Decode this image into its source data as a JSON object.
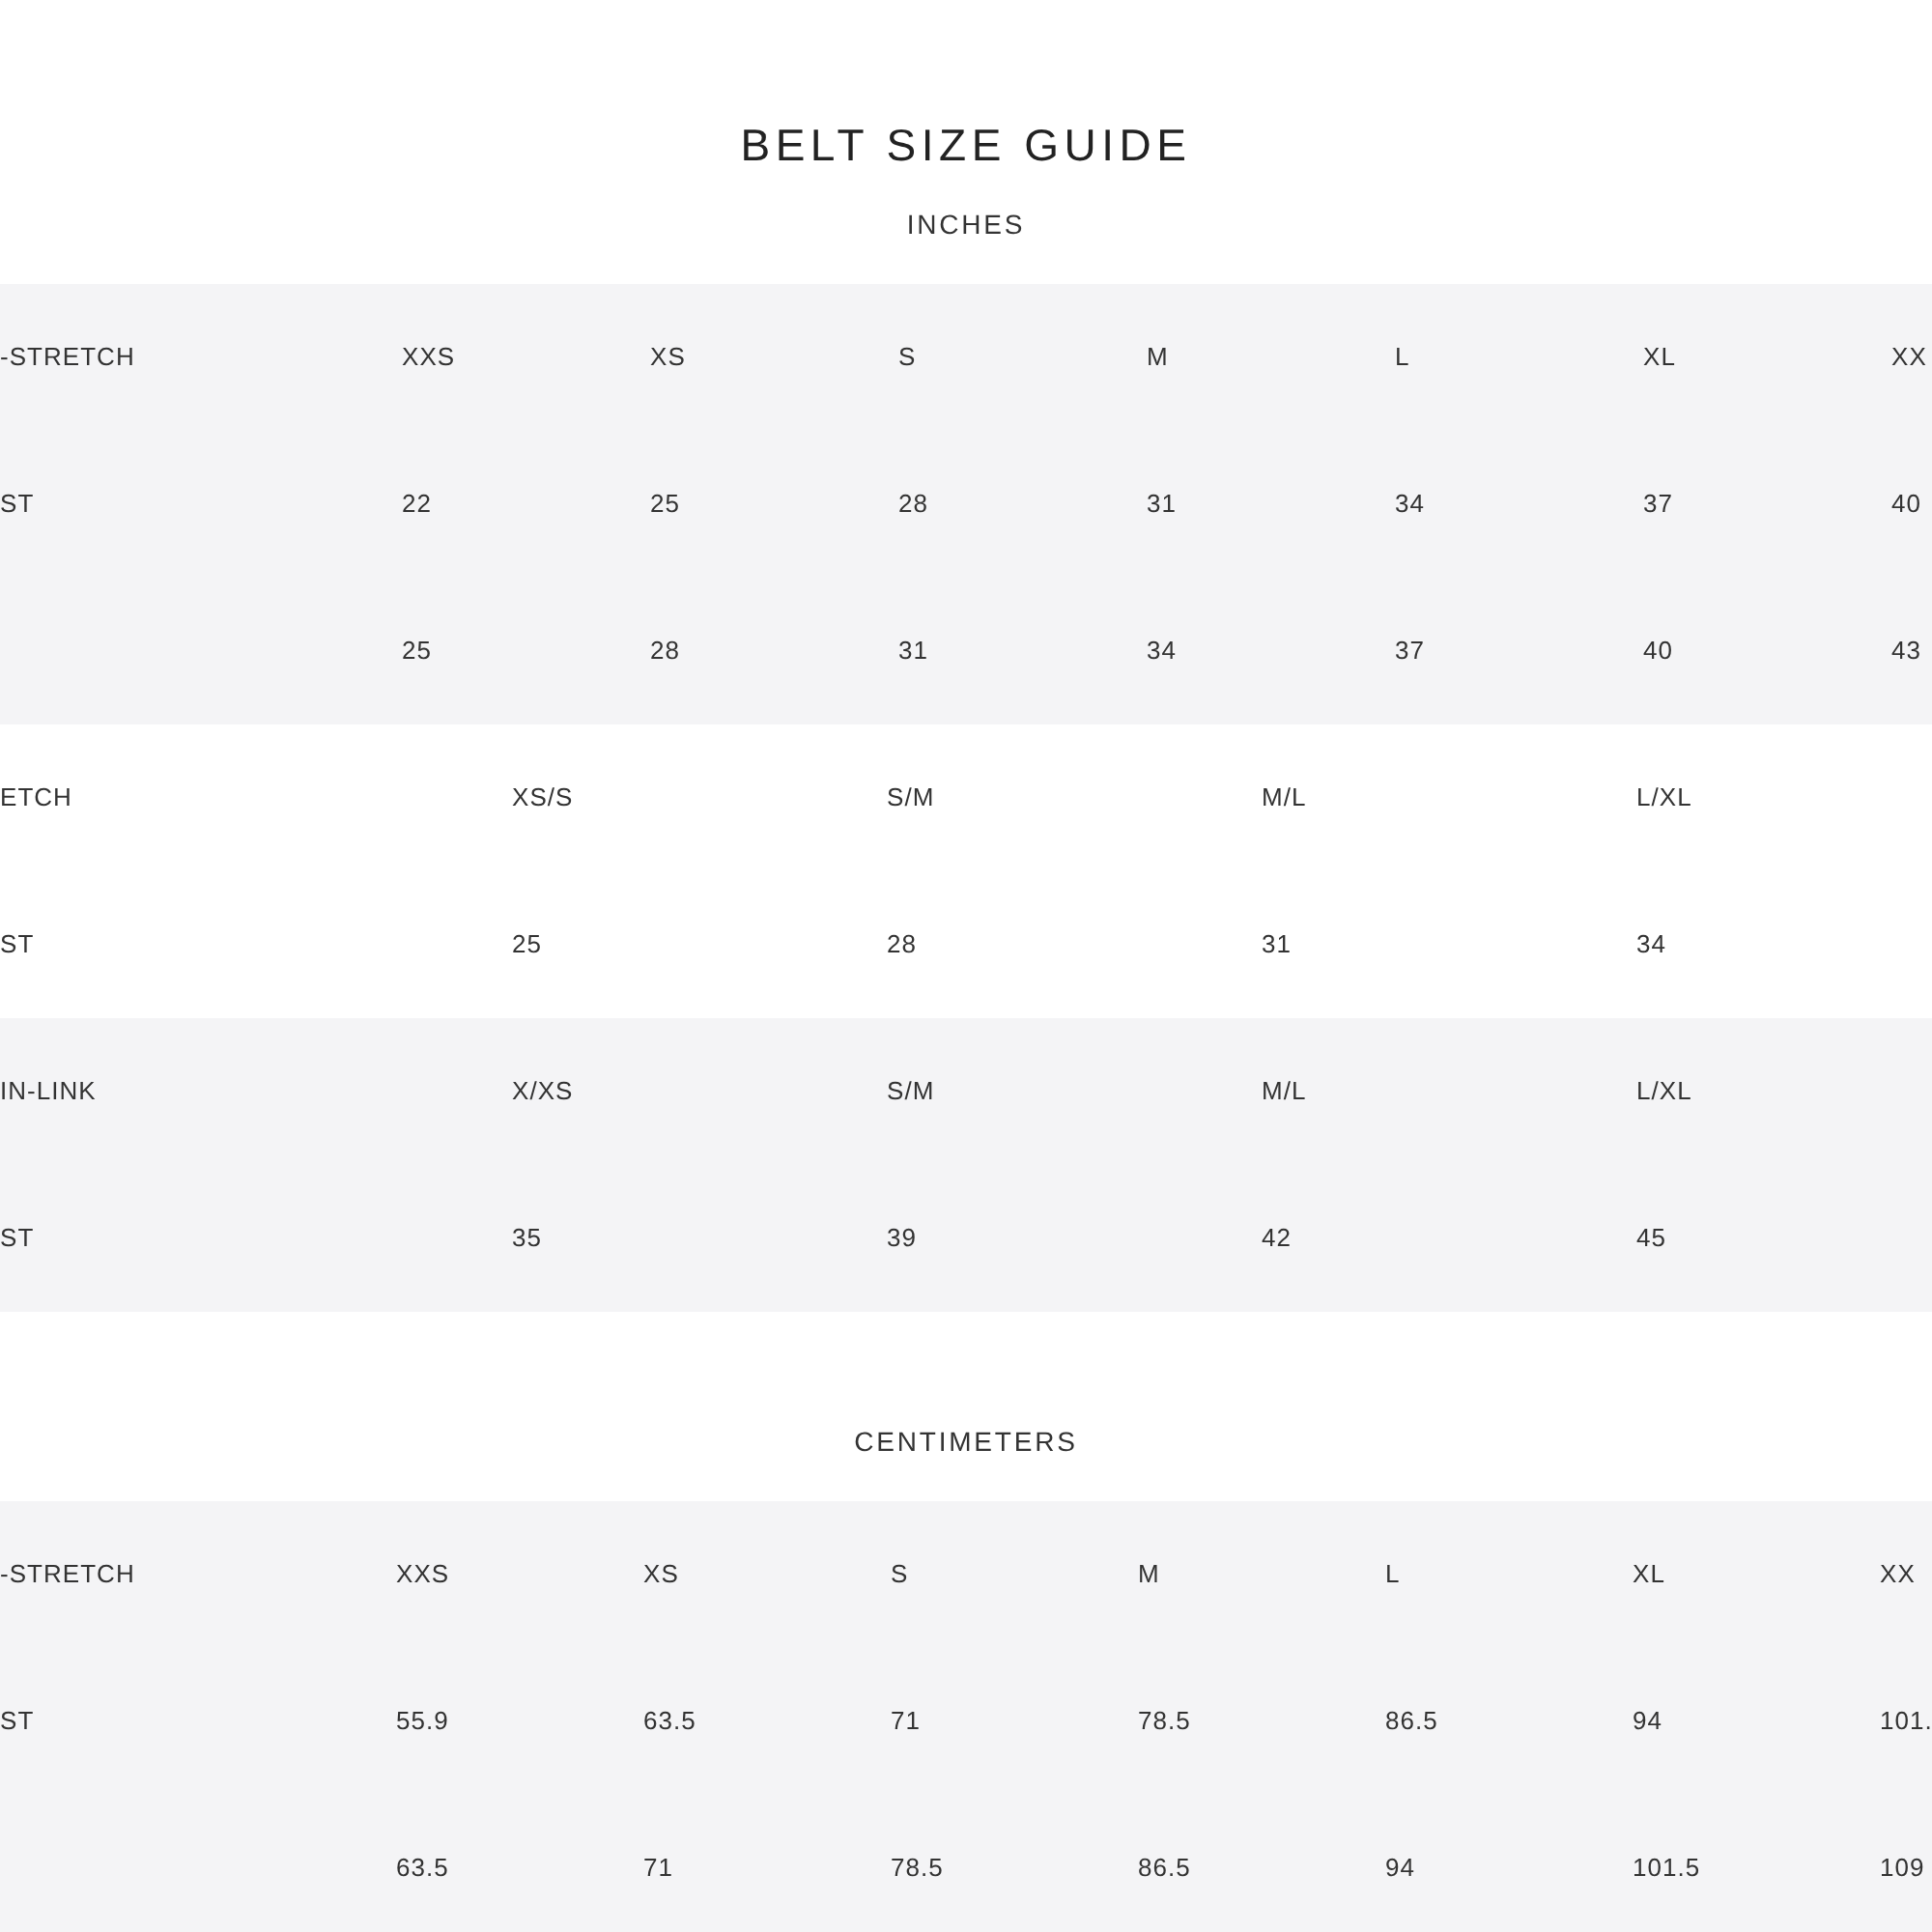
{
  "title": "BELT SIZE GUIDE",
  "sections": [
    {
      "heading": "INCHES",
      "tables": [
        {
          "rows": [
            [
              "-STRETCH",
              "XXS",
              "XS",
              "S",
              "M",
              "L",
              "XL",
              "XX"
            ],
            [
              "ST",
              "22",
              "25",
              "28",
              "31",
              "34",
              "37",
              "40"
            ],
            [
              "",
              "25",
              "28",
              "31",
              "34",
              "37",
              "40",
              "43"
            ]
          ]
        },
        {
          "rows": [
            [
              "ETCH",
              "XS/S",
              "S/M",
              "M/L",
              "L/XL"
            ],
            [
              "ST",
              "25",
              "28",
              "31",
              "34"
            ]
          ]
        },
        {
          "rows": [
            [
              "IN-LINK",
              "X/XS",
              "S/M",
              "M/L",
              "L/XL"
            ],
            [
              "ST",
              "35",
              "39",
              "42",
              "45"
            ]
          ]
        }
      ]
    },
    {
      "heading": "CENTIMETERS",
      "tables": [
        {
          "rows": [
            [
              "-STRETCH",
              "XXS",
              "XS",
              "S",
              "M",
              "L",
              "XL",
              "XX"
            ],
            [
              "ST",
              "55.9",
              "63.5",
              "71",
              "78.5",
              "86.5",
              "94",
              "101."
            ],
            [
              "",
              "63.5",
              "71",
              "78.5",
              "86.5",
              "94",
              "101.5",
              "109"
            ]
          ]
        }
      ]
    }
  ]
}
